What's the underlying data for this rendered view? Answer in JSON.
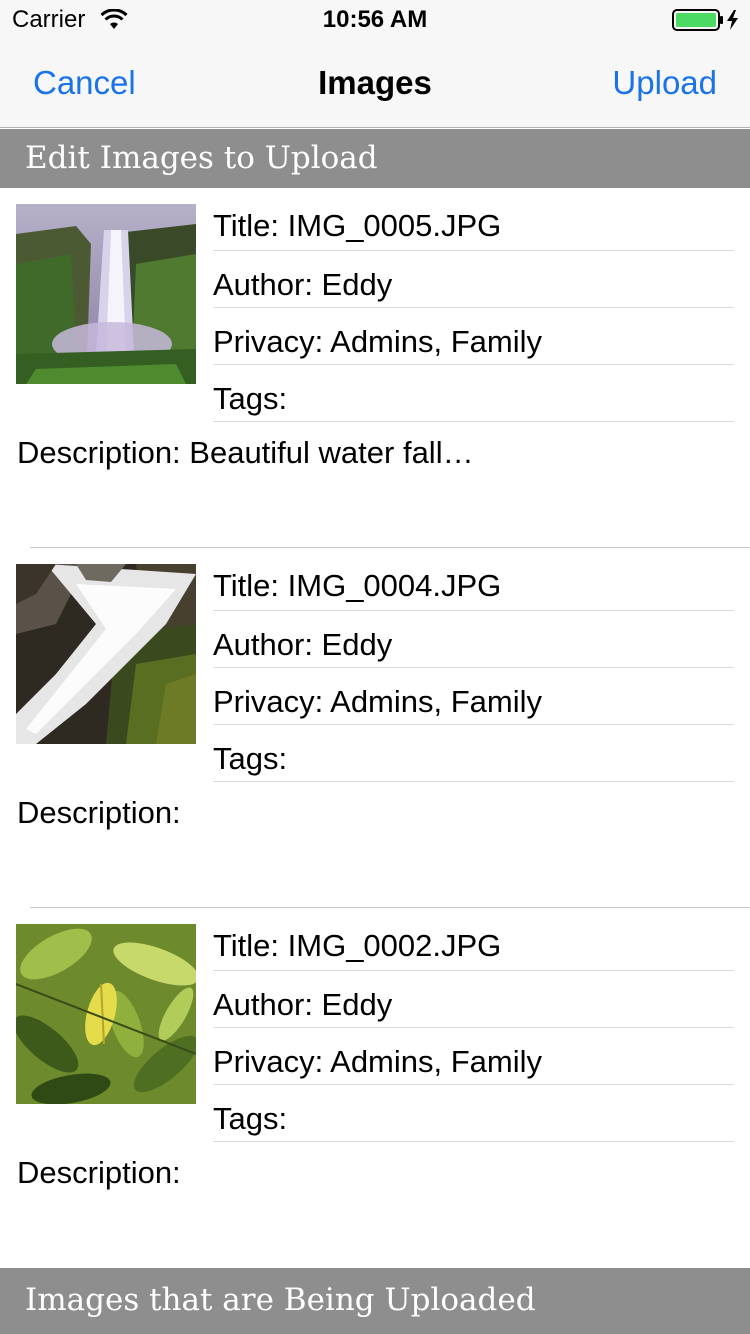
{
  "status_bar": {
    "carrier": "Carrier",
    "time": "10:56 AM",
    "wifi_icon": "wifi-icon",
    "battery_icon": "battery-charging-icon",
    "battery_color": "#4cd964"
  },
  "nav": {
    "cancel_label": "Cancel",
    "title": "Images",
    "upload_label": "Upload",
    "accent_color": "#1a73e8"
  },
  "sections": {
    "edit_header": "Edit Images to Upload",
    "uploading_header": "Images that are Being Uploaded"
  },
  "images": [
    {
      "thumbnail": "waterfall-cliff-thumbnail",
      "title": "Title: IMG_0005.JPG",
      "author": "Author: Eddy",
      "privacy": "Privacy: Admins, Family",
      "tags": "Tags:",
      "description": "Description: Beautiful water fall…"
    },
    {
      "thumbnail": "waterfall-rocks-thumbnail",
      "title": "Title: IMG_0004.JPG",
      "author": "Author: Eddy",
      "privacy": "Privacy: Admins, Family",
      "tags": "Tags:",
      "description": "Description:"
    },
    {
      "thumbnail": "green-leaves-thumbnail",
      "title": "Title: IMG_0002.JPG",
      "author": "Author: Eddy",
      "privacy": "Privacy: Admins, Family",
      "tags": "Tags:",
      "description": "Description:"
    }
  ]
}
